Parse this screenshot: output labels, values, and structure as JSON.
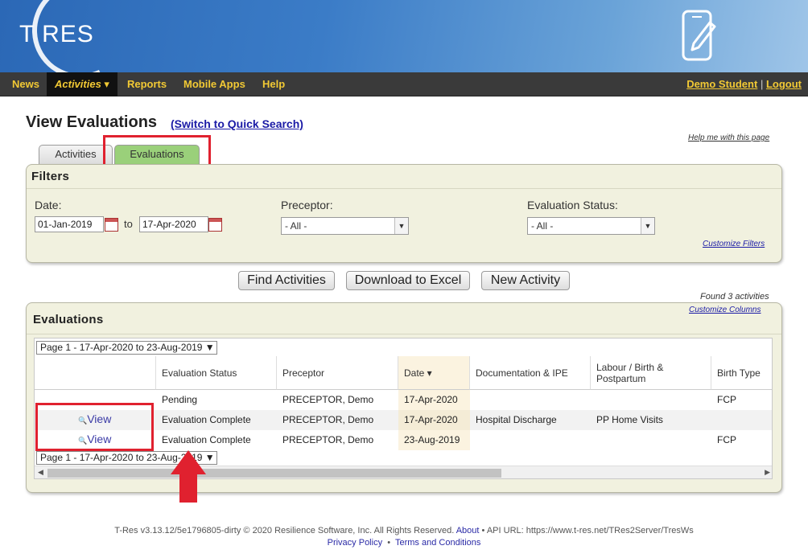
{
  "header": {
    "logo": "T RES"
  },
  "nav": {
    "items": [
      "News",
      "Activities ▾",
      "Reports",
      "Mobile Apps",
      "Help"
    ],
    "user": "Demo Student",
    "separator": "|",
    "logout": "Logout"
  },
  "page": {
    "title": "View Evaluations",
    "switch_link": "(Switch to Quick Search)",
    "help_link": "Help me with this page"
  },
  "tabs": [
    {
      "label": "Activities"
    },
    {
      "label": "Evaluations"
    }
  ],
  "filters": {
    "title": "Filters",
    "date_label": "Date:",
    "date_from": "01-Jan-2019",
    "to_label": "to",
    "date_to": "17-Apr-2020",
    "preceptor_label": "Preceptor:",
    "preceptor_value": "- All -",
    "status_label": "Evaluation Status:",
    "status_value": "- All -",
    "customize": "Customize Filters"
  },
  "buttons": {
    "find": "Find Activities",
    "download": "Download to Excel",
    "new": "New Activity"
  },
  "results": {
    "found": "Found 3 activities",
    "customize_columns": "Customize Columns"
  },
  "evaluations": {
    "title": "Evaluations",
    "pager": "Page 1 - 17-Apr-2020 to 23-Aug-2019 ▼",
    "columns": [
      "",
      "Evaluation Status",
      "Preceptor",
      "Date ▾",
      "Documentation & IPE",
      "Labour / Birth & Postpartum",
      "Birth Type"
    ],
    "rows": [
      {
        "action": "",
        "status": "Pending",
        "preceptor": "PRECEPTOR, Demo",
        "date": "17-Apr-2020",
        "doc": "",
        "labour": "",
        "birth": "FCP"
      },
      {
        "action": "View",
        "status": "Evaluation Complete",
        "preceptor": "PRECEPTOR, Demo",
        "date": "17-Apr-2020",
        "doc": "Hospital Discharge",
        "labour": "PP Home Visits",
        "birth": ""
      },
      {
        "action": "View",
        "status": "Evaluation Complete",
        "preceptor": "PRECEPTOR, Demo",
        "date": "23-Aug-2019",
        "doc": "",
        "labour": "",
        "birth": "FCP"
      }
    ]
  },
  "footer": {
    "line1": "T-Res v3.13.12/5e1796805-dirty © 2020 Resilience Software, Inc. All Rights Reserved.",
    "about": "About",
    "bullet": "•",
    "api": "API URL: https://www.t-res.net/TRes2Server/TresWs",
    "privacy": "Privacy Policy",
    "terms": "Terms and Conditions"
  },
  "colors": {
    "accent_red": "#e0212f",
    "nav_yellow": "#f2c934",
    "tab_green": "#9ad07a"
  }
}
